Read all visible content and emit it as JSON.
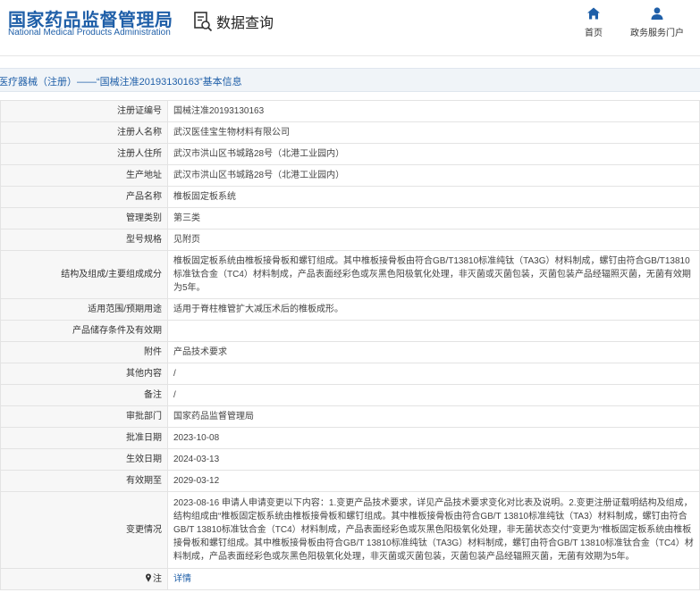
{
  "header": {
    "logo_cn": "国家药品监督管理局",
    "logo_en": "National Medical Products Administration",
    "query_icon": "document-search-icon",
    "query_label": "数据查询",
    "nav": [
      {
        "label": "首页",
        "icon": "home-icon"
      },
      {
        "label": "政务服务门户",
        "icon": "user-icon"
      }
    ]
  },
  "breadcrumb": "医疗器械（注册）——“国械注准20193130163”基本信息",
  "colors": {
    "brand": "#1f5fa8",
    "label_bg": "#f7f7f7",
    "border": "#e3e3e3",
    "breadcrumb_bg": "#f0f4f8"
  },
  "rows": [
    {
      "label": "注册证编号",
      "value": "国械注准20193130163"
    },
    {
      "label": "注册人名称",
      "value": "武汉医佳宝生物材料有限公司"
    },
    {
      "label": "注册人住所",
      "value": "武汉市洪山区书城路28号（北港工业园内）"
    },
    {
      "label": "生产地址",
      "value": "武汉市洪山区书城路28号（北港工业园内）"
    },
    {
      "label": "产品名称",
      "value": "椎板固定板系统"
    },
    {
      "label": "管理类别",
      "value": "第三类"
    },
    {
      "label": "型号规格",
      "value": "见附页"
    },
    {
      "label": "结构及组成/主要组成成分",
      "value": "椎板固定板系统由椎板接骨板和螺钉组成。其中椎板接骨板由符合GB/T13810标准纯钛（TA3G）材料制成，螺钉由符合GB/T13810标准钛合金（TC4）材料制成，产品表面经彩色或灰黑色阳极氧化处理，非灭菌或灭菌包装，灭菌包装产品经辐照灭菌，无菌有效期为5年。"
    },
    {
      "label": "适用范围/预期用途",
      "value": "适用于脊柱椎管扩大减压术后的椎板成形。"
    },
    {
      "label": "产品储存条件及有效期",
      "value": ""
    },
    {
      "label": "附件",
      "value": "产品技术要求"
    },
    {
      "label": "其他内容",
      "value": "/"
    },
    {
      "label": "备注",
      "value": "/"
    },
    {
      "label": "审批部门",
      "value": "国家药品监督管理局"
    },
    {
      "label": "批准日期",
      "value": "2023-10-08"
    },
    {
      "label": "生效日期",
      "value": "2024-03-13"
    },
    {
      "label": "有效期至",
      "value": "2029-03-12"
    },
    {
      "label": "变更情况",
      "value": "2023-08-16 申请人申请变更以下内容：1.变更产品技术要求，详见产品技术要求变化对比表及说明。2.变更注册证载明结构及组成，结构组成由“椎板固定板系统由椎板接骨板和螺钉组成。其中椎板接骨板由符合GB/T 13810标准纯钛（TA3）材料制成，螺钉由符合GB/T 13810标准钛合金（TC4）材料制成，产品表面经彩色或灰黑色阳极氧化处理，非无菌状态交付”变更为“椎板固定板系统由椎板接骨板和螺钉组成。其中椎板接骨板由符合GB/T 13810标准纯钛（TA3G）材料制成，螺钉由符合GB/T 13810标准钛合金（TC4）材料制成，产品表面经彩色或灰黑色阳极氧化处理，非灭菌或灭菌包装，灭菌包装产品经辐照灭菌，无菌有效期为5年。"
    }
  ],
  "note": {
    "label": "注",
    "icon": "pin-icon",
    "link": "详情"
  }
}
